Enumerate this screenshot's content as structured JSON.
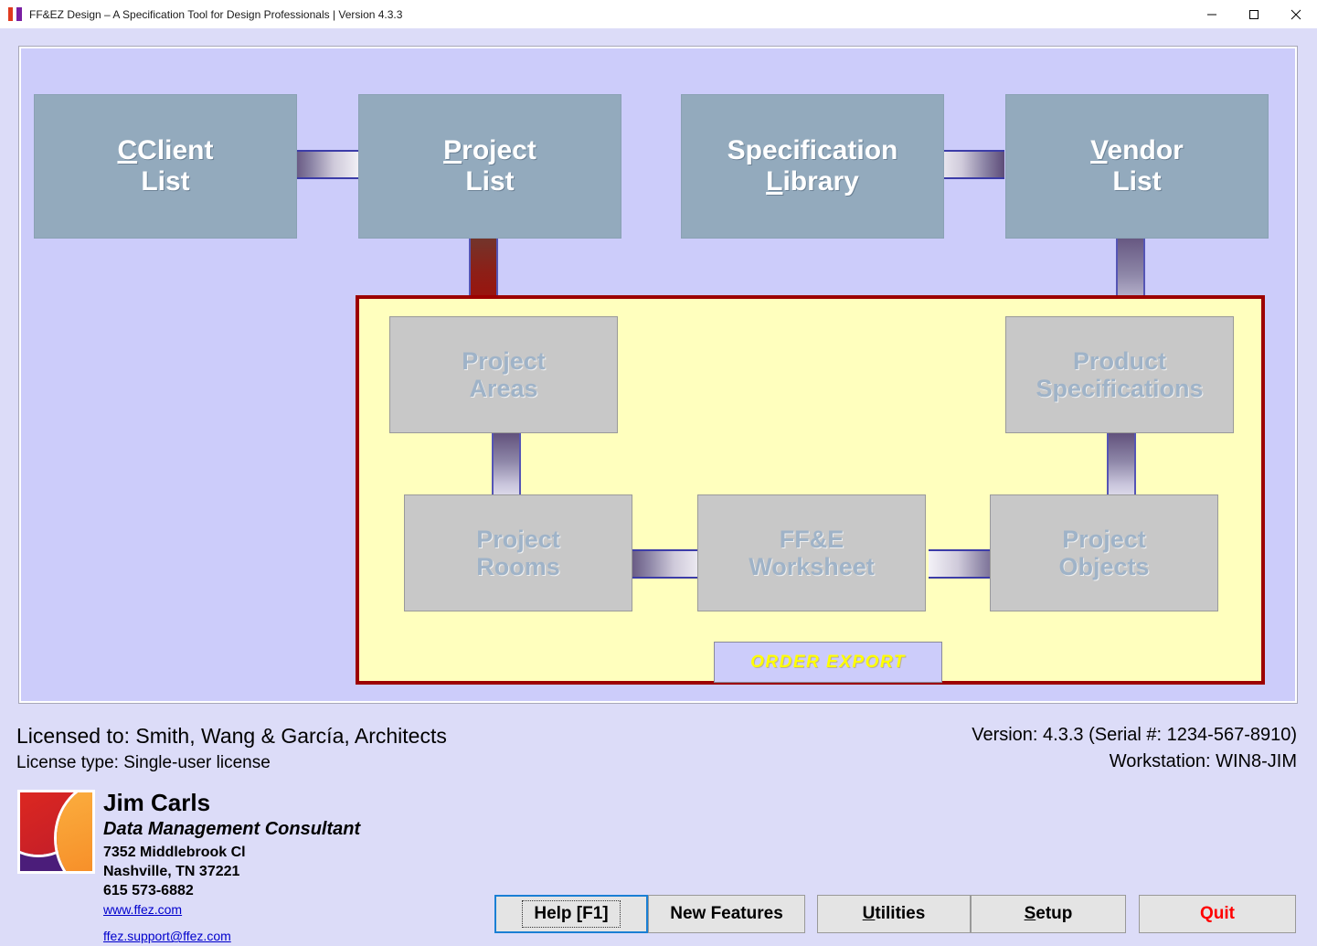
{
  "window": {
    "title": "FF&EZ Design – A Specification Tool for Design Professionals | Version 4.3.3",
    "minimize_label": "Minimize",
    "maximize_label": "Maximize",
    "close_label": "Close"
  },
  "flow": {
    "top_boxes": [
      {
        "line1": "Client",
        "line2": "List",
        "accel_line": 1,
        "accel_char": "C",
        "state": "enabled"
      },
      {
        "line1": "Project",
        "line2": "List",
        "accel_line": 1,
        "accel_char": "P",
        "state": "enabled"
      },
      {
        "line1": "Specification",
        "line2": "Library",
        "accel_line": 2,
        "accel_char": "L",
        "state": "enabled"
      },
      {
        "line1": "Vendor",
        "line2": "List",
        "accel_line": 1,
        "accel_char": "V",
        "state": "enabled"
      }
    ],
    "project_boxes": [
      {
        "line1": "Project",
        "line2": "Areas",
        "state": "disabled"
      },
      {
        "line1": "Product",
        "line2": "Specifications",
        "state": "disabled"
      },
      {
        "line1": "Project",
        "line2": "Rooms",
        "state": "disabled"
      },
      {
        "line1": "FF&E",
        "line2": "Worksheet",
        "state": "disabled"
      },
      {
        "line1": "Project",
        "line2": "Objects",
        "state": "disabled"
      }
    ],
    "order_export_label": "ORDER  EXPORT"
  },
  "footer": {
    "licensed_to": "Licensed to: Smith, Wang & García, Architects",
    "license_type": "License type: Single-user license",
    "version_line": "Version: 4.3.3   (Serial #: 1234-567-8910)",
    "workstation_line": "Workstation: WIN8-JIM"
  },
  "contact": {
    "name": "Jim Carls",
    "role": "Data Management Consultant",
    "address1": "7352 Middlebrook Cl",
    "address2": "Nashville, TN  37221",
    "phone": "615 573-6882",
    "website": "www.ffez.com",
    "email": "ffez.support@ffez.com"
  },
  "buttons": [
    {
      "label": "Help [F1]",
      "accel": "",
      "focused": true,
      "style": "normal"
    },
    {
      "label": "New Features",
      "accel": "",
      "focused": false,
      "style": "normal"
    },
    {
      "label": "Utilities",
      "accel": "U",
      "focused": false,
      "style": "normal"
    },
    {
      "label": "Setup",
      "accel": "S",
      "focused": false,
      "style": "normal"
    },
    {
      "label": "Quit",
      "accel": "",
      "focused": false,
      "style": "danger"
    }
  ],
  "colors": {
    "window_bg": "#dcdcf8",
    "panel_bg": "#ccccfa",
    "active_box": "#93aabd",
    "disabled_box": "#c8c8c8",
    "project_panel_bg": "#ffffbe",
    "project_panel_border": "#9c0000",
    "accent_link": "#0000cc",
    "quit_text": "#ff0000",
    "order_export_text": "#ffff00"
  }
}
